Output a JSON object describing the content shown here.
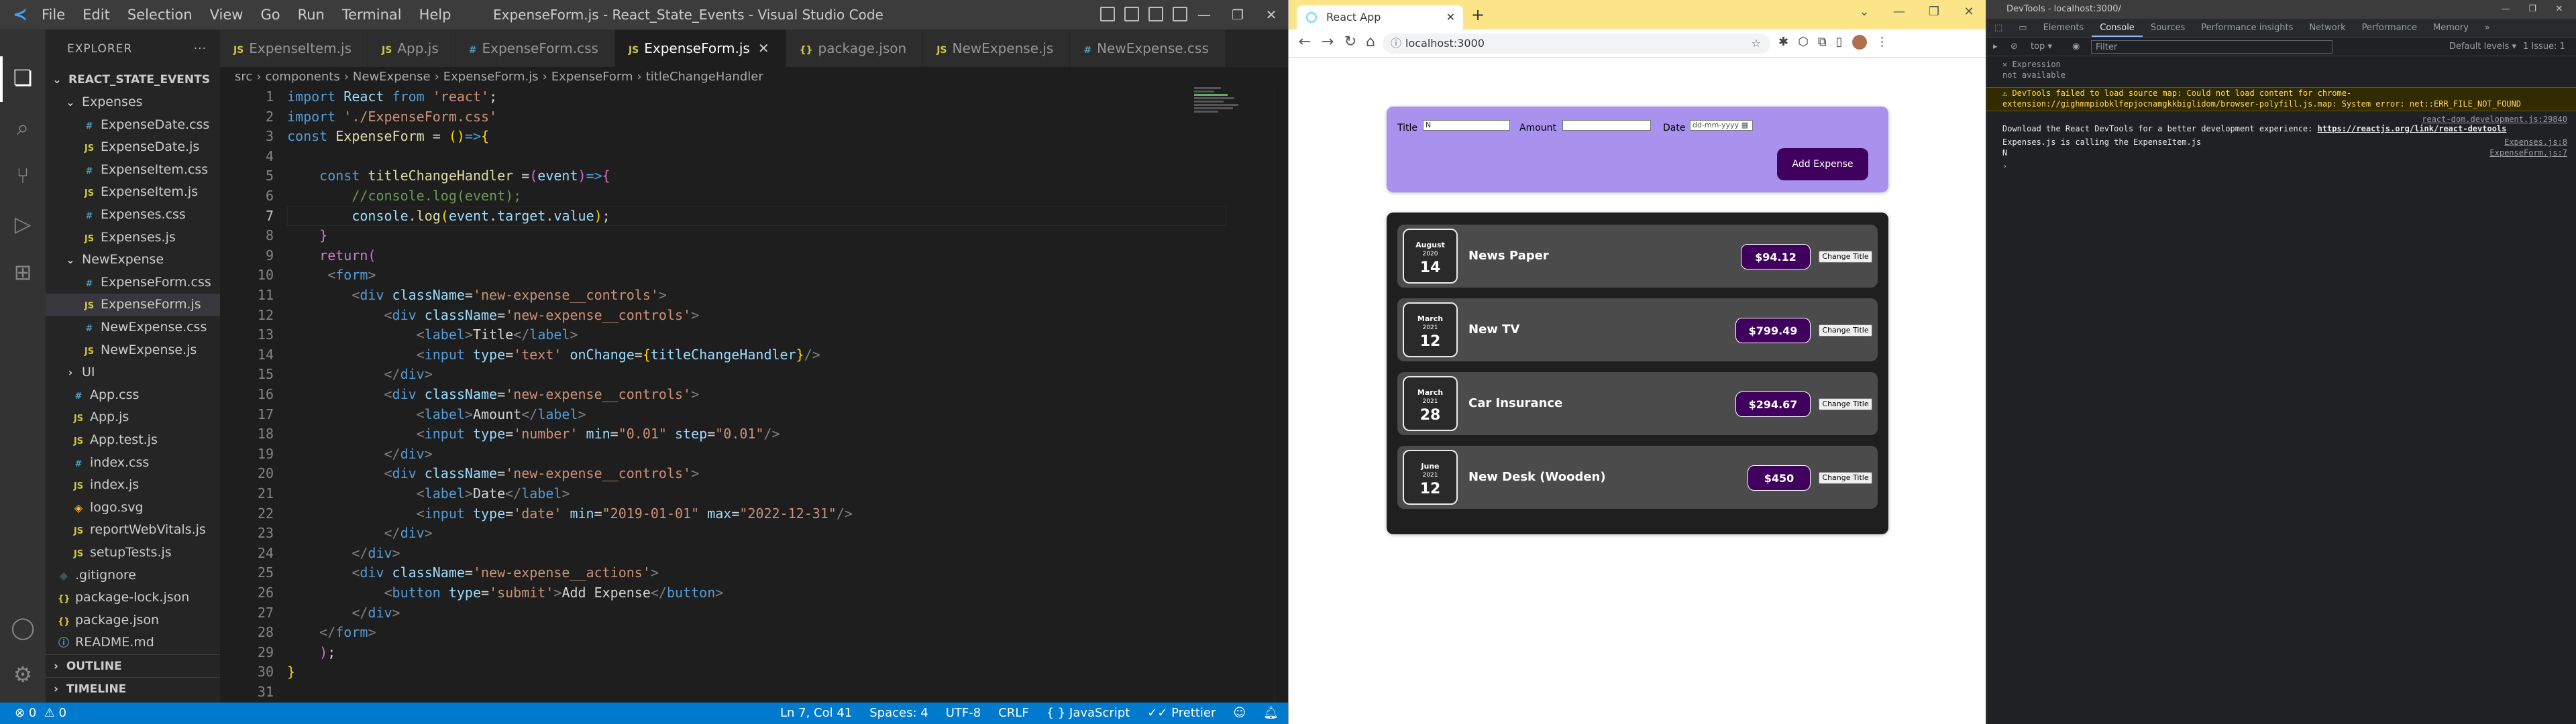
{
  "vscode": {
    "window_title": "ExpenseForm.js - React_State_Events - Visual Studio Code",
    "menu": [
      "File",
      "Edit",
      "Selection",
      "View",
      "Go",
      "Run",
      "Terminal",
      "Help"
    ],
    "explorer_label": "EXPLORER",
    "project": "REACT_STATE_EVENTS",
    "tree": [
      {
        "label": "Expenses",
        "type": "folder",
        "indent": 1
      },
      {
        "label": "ExpenseDate.css",
        "type": "css",
        "indent": 2
      },
      {
        "label": "ExpenseDate.js",
        "type": "js",
        "indent": 2
      },
      {
        "label": "ExpenseItem.css",
        "type": "css",
        "indent": 2
      },
      {
        "label": "ExpenseItem.js",
        "type": "js",
        "indent": 2
      },
      {
        "label": "Expenses.css",
        "type": "css",
        "indent": 2
      },
      {
        "label": "Expenses.js",
        "type": "js",
        "indent": 2
      },
      {
        "label": "NewExpense",
        "type": "folder",
        "indent": 1
      },
      {
        "label": "ExpenseForm.css",
        "type": "css",
        "indent": 2
      },
      {
        "label": "ExpenseForm.js",
        "type": "js",
        "indent": 2,
        "selected": true
      },
      {
        "label": "NewExpense.css",
        "type": "css",
        "indent": 2
      },
      {
        "label": "NewExpense.js",
        "type": "js",
        "indent": 2
      },
      {
        "label": "UI",
        "type": "folder-closed",
        "indent": 1
      },
      {
        "label": "App.css",
        "type": "css",
        "indent": 0
      },
      {
        "label": "App.js",
        "type": "js",
        "indent": 0
      },
      {
        "label": "App.test.js",
        "type": "js",
        "indent": 0
      },
      {
        "label": "index.css",
        "type": "css",
        "indent": 0
      },
      {
        "label": "index.js",
        "type": "js",
        "indent": 0
      },
      {
        "label": "logo.svg",
        "type": "svg",
        "indent": 0
      },
      {
        "label": "reportWebVitals.js",
        "type": "js",
        "indent": 0
      },
      {
        "label": "setupTests.js",
        "type": "js",
        "indent": 0
      },
      {
        "label": ".gitignore",
        "type": "git",
        "indent": -1
      },
      {
        "label": "package-lock.json",
        "type": "json",
        "indent": -1
      },
      {
        "label": "package.json",
        "type": "json",
        "indent": -1
      },
      {
        "label": "README.md",
        "type": "md",
        "indent": -1
      }
    ],
    "outline": "OUTLINE",
    "timeline": "TIMELINE",
    "tabs": [
      {
        "label": "ExpenseItem.js",
        "type": "js"
      },
      {
        "label": "App.js",
        "type": "js"
      },
      {
        "label": "ExpenseForm.css",
        "type": "css"
      },
      {
        "label": "ExpenseForm.js",
        "type": "js",
        "active": true
      },
      {
        "label": "package.json",
        "type": "json"
      },
      {
        "label": "NewExpense.js",
        "type": "js"
      },
      {
        "label": "NewExpense.css",
        "type": "css"
      }
    ],
    "breadcrumb": [
      "src",
      "components",
      "NewExpense",
      "ExpenseForm.js",
      "ExpenseForm",
      "titleChangeHandler"
    ],
    "code": [
      [
        [
          "k",
          "import "
        ],
        [
          "v",
          "React "
        ],
        [
          "k",
          "from "
        ],
        [
          "s",
          "'react'"
        ],
        [
          "",
          "; "
        ]
      ],
      [
        [
          "k",
          "import "
        ],
        [
          "s",
          "'./ExpenseForm.css'"
        ]
      ],
      [
        [
          "k",
          "const "
        ],
        [
          "f",
          "ExpenseForm "
        ],
        [
          "",
          "= "
        ],
        [
          "br",
          "()"
        ],
        [
          "k",
          "=>"
        ],
        [
          "br",
          "{"
        ]
      ],
      [],
      [
        [
          "",
          "    "
        ],
        [
          "k",
          "const "
        ],
        [
          "f",
          "titleChangeHandler "
        ],
        [
          "",
          "="
        ],
        [
          "br2",
          "("
        ],
        [
          "v",
          "event"
        ],
        [
          "br2",
          ")"
        ],
        [
          "k",
          "=>"
        ],
        [
          "br2",
          "{"
        ]
      ],
      [
        [
          "",
          "        "
        ],
        [
          "c",
          "//console.log(event);"
        ]
      ],
      [
        [
          "",
          "        "
        ],
        [
          "v",
          "console"
        ],
        [
          "",
          "."
        ],
        [
          "f",
          "log"
        ],
        [
          "br",
          "("
        ],
        [
          "v",
          "event"
        ],
        [
          "",
          "."
        ],
        [
          "v",
          "target"
        ],
        [
          "",
          "."
        ],
        [
          "v",
          "value"
        ],
        [
          "br",
          ")"
        ],
        [
          "",
          ";"
        ]
      ],
      [
        [
          "",
          "    "
        ],
        [
          "br2",
          "}"
        ]
      ],
      [
        [
          "",
          "    "
        ],
        [
          "kw",
          "return"
        ],
        [
          "br2",
          "("
        ]
      ],
      [
        [
          "",
          "     "
        ],
        [
          "gr",
          "<"
        ],
        [
          "tg",
          "form"
        ],
        [
          "gr",
          ">"
        ]
      ],
      [
        [
          "",
          "        "
        ],
        [
          "gr",
          "<"
        ],
        [
          "tg",
          "div "
        ],
        [
          "at",
          "className"
        ],
        [
          "",
          "="
        ],
        [
          "s",
          "'new-expense__controls'"
        ],
        [
          "gr",
          ">"
        ]
      ],
      [
        [
          "",
          "            "
        ],
        [
          "gr",
          "<"
        ],
        [
          "tg",
          "div "
        ],
        [
          "at",
          "className"
        ],
        [
          "",
          "="
        ],
        [
          "s",
          "'new-expense__controls'"
        ],
        [
          "gr",
          ">"
        ]
      ],
      [
        [
          "",
          "                "
        ],
        [
          "gr",
          "<"
        ],
        [
          "tg",
          "label"
        ],
        [
          "gr",
          ">"
        ],
        [
          "",
          "Title"
        ],
        [
          "gr",
          "</"
        ],
        [
          "tg",
          "label"
        ],
        [
          "gr",
          ">"
        ]
      ],
      [
        [
          "",
          "                "
        ],
        [
          "gr",
          "<"
        ],
        [
          "tg",
          "input "
        ],
        [
          "at",
          "type"
        ],
        [
          "",
          "="
        ],
        [
          "s",
          "'text' "
        ],
        [
          "at",
          "onChange"
        ],
        [
          "",
          "="
        ],
        [
          "br",
          "{"
        ],
        [
          "v",
          "titleChangeHandler"
        ],
        [
          "br",
          "}"
        ],
        [
          "gr",
          "/>"
        ]
      ],
      [
        [
          "",
          "            "
        ],
        [
          "gr",
          "</"
        ],
        [
          "tg",
          "div"
        ],
        [
          "gr",
          ">"
        ]
      ],
      [
        [
          "",
          "            "
        ],
        [
          "gr",
          "<"
        ],
        [
          "tg",
          "div "
        ],
        [
          "at",
          "className"
        ],
        [
          "",
          "="
        ],
        [
          "s",
          "'new-expense__controls'"
        ],
        [
          "gr",
          ">"
        ]
      ],
      [
        [
          "",
          "                "
        ],
        [
          "gr",
          "<"
        ],
        [
          "tg",
          "label"
        ],
        [
          "gr",
          ">"
        ],
        [
          "",
          "Amount"
        ],
        [
          "gr",
          "</"
        ],
        [
          "tg",
          "label"
        ],
        [
          "gr",
          ">"
        ]
      ],
      [
        [
          "",
          "                "
        ],
        [
          "gr",
          "<"
        ],
        [
          "tg",
          "input "
        ],
        [
          "at",
          "type"
        ],
        [
          "",
          "="
        ],
        [
          "s",
          "'number' "
        ],
        [
          "at",
          "min"
        ],
        [
          "",
          "="
        ],
        [
          "s",
          "\"0.01\" "
        ],
        [
          "at",
          "step"
        ],
        [
          "",
          "="
        ],
        [
          "s",
          "\"0.01\""
        ],
        [
          "gr",
          "/>"
        ]
      ],
      [
        [
          "",
          "            "
        ],
        [
          "gr",
          "</"
        ],
        [
          "tg",
          "div"
        ],
        [
          "gr",
          ">"
        ]
      ],
      [
        [
          "",
          "            "
        ],
        [
          "gr",
          "<"
        ],
        [
          "tg",
          "div "
        ],
        [
          "at",
          "className"
        ],
        [
          "",
          "="
        ],
        [
          "s",
          "'new-expense__controls'"
        ],
        [
          "gr",
          ">"
        ]
      ],
      [
        [
          "",
          "                "
        ],
        [
          "gr",
          "<"
        ],
        [
          "tg",
          "label"
        ],
        [
          "gr",
          ">"
        ],
        [
          "",
          "Date"
        ],
        [
          "gr",
          "</"
        ],
        [
          "tg",
          "label"
        ],
        [
          "gr",
          ">"
        ]
      ],
      [
        [
          "",
          "                "
        ],
        [
          "gr",
          "<"
        ],
        [
          "tg",
          "input "
        ],
        [
          "at",
          "type"
        ],
        [
          "",
          "="
        ],
        [
          "s",
          "'date' "
        ],
        [
          "at",
          "min"
        ],
        [
          "",
          "="
        ],
        [
          "s",
          "\"2019-01-01\" "
        ],
        [
          "at",
          "max"
        ],
        [
          "",
          "="
        ],
        [
          "s",
          "\"2022-12-31\""
        ],
        [
          "gr",
          "/>"
        ]
      ],
      [
        [
          "",
          "            "
        ],
        [
          "gr",
          "</"
        ],
        [
          "tg",
          "div"
        ],
        [
          "gr",
          ">"
        ]
      ],
      [
        [
          "",
          "        "
        ],
        [
          "gr",
          "</"
        ],
        [
          "tg",
          "div"
        ],
        [
          "gr",
          ">"
        ]
      ],
      [
        [
          "",
          "        "
        ],
        [
          "gr",
          "<"
        ],
        [
          "tg",
          "div "
        ],
        [
          "at",
          "className"
        ],
        [
          "",
          "="
        ],
        [
          "s",
          "'new-expense__actions'"
        ],
        [
          "gr",
          ">"
        ]
      ],
      [
        [
          "",
          "            "
        ],
        [
          "gr",
          "<"
        ],
        [
          "tg",
          "button "
        ],
        [
          "at",
          "type"
        ],
        [
          "",
          "="
        ],
        [
          "s",
          "'submit'"
        ],
        [
          "gr",
          ">"
        ],
        [
          "",
          "Add Expense"
        ],
        [
          "gr",
          "</"
        ],
        [
          "tg",
          "button"
        ],
        [
          "gr",
          ">"
        ]
      ],
      [
        [
          "",
          "        "
        ],
        [
          "gr",
          "</"
        ],
        [
          "tg",
          "div"
        ],
        [
          "gr",
          ">"
        ]
      ],
      [
        [
          "",
          "    "
        ],
        [
          "gr",
          "</"
        ],
        [
          "tg",
          "form"
        ],
        [
          "gr",
          ">"
        ]
      ],
      [
        [
          "",
          "    "
        ],
        [
          "br2",
          ")"
        ],
        [
          "",
          ";"
        ]
      ],
      [
        [
          "br",
          "}"
        ]
      ],
      [],
      [
        [
          "k",
          "export "
        ],
        [
          "k",
          "default "
        ],
        [
          "f",
          "ExpenseForm"
        ],
        [
          "",
          ";"
        ]
      ]
    ],
    "status": {
      "errors": "0",
      "warnings": "0",
      "position": "Ln 7, Col 41",
      "spaces": "Spaces: 4",
      "encoding": "UTF-8",
      "eol": "CRLF",
      "language": "JavaScript",
      "formatter": "Prettier"
    },
    "colors": {
      "statusbar": "#007acc",
      "editor_bg": "#1e1e1e",
      "sidebar_bg": "#252526"
    }
  },
  "chrome": {
    "tab_title": "React App",
    "url": "localhost:3000",
    "form": {
      "title_label": "Title",
      "title_value": "N",
      "amount_label": "Amount",
      "amount_value": "",
      "date_label": "Date",
      "date_placeholder": "dd-mm-yyyy",
      "submit_label": "Add Expense"
    },
    "expenses": [
      {
        "month": "August",
        "year": "2020",
        "day": "14",
        "title": "News Paper",
        "amount": "$94.12",
        "button": "Change Title"
      },
      {
        "month": "March",
        "year": "2021",
        "day": "12",
        "title": "New TV",
        "amount": "$799.49",
        "button": "Change Title"
      },
      {
        "month": "March",
        "year": "2021",
        "day": "28",
        "title": "Car Insurance",
        "amount": "$294.67",
        "button": "Change Title"
      },
      {
        "month": "June",
        "year": "2021",
        "day": "12",
        "title": "New Desk (Wooden)",
        "amount": "$450",
        "button": "Change Title"
      }
    ],
    "colors": {
      "form_bg": "#a892ee",
      "list_bg": "#1f1f1f",
      "item_bg": "#4b4b4b",
      "price_bg": "#40005d",
      "tab_strip": "#fbe588"
    }
  },
  "devtools": {
    "window_title": "DevTools - localhost:3000/",
    "tabs": [
      "Elements",
      "Console",
      "Sources",
      "Performance insights",
      "Network",
      "Performance",
      "Memory"
    ],
    "active_tab": "Console",
    "context": "top",
    "filter_placeholder": "Filter",
    "levels": "Default levels",
    "issues": "1 Issue: 1",
    "expression_label": "Expression",
    "expression_value": "not available",
    "warning_text": "DevTools failed to load source map: Could not load content for chrome-extension://gighmmpiobklfepjocnamgkkbiglidom/browser-polyfill.js.map: System error: net::ERR_FILE_NOT_FOUND",
    "log1_src": "react-dom.development.js:29840",
    "log1_text": "Download the React DevTools for a better development experience: ",
    "log1_link": "https://reactjs.org/link/react-devtools",
    "log2_text": "Expenses.js is calling the ExpenseItem.js",
    "log2_src": "Expenses.js:8",
    "log3_text": "N",
    "log3_src": "ExpenseForm.js:7"
  }
}
